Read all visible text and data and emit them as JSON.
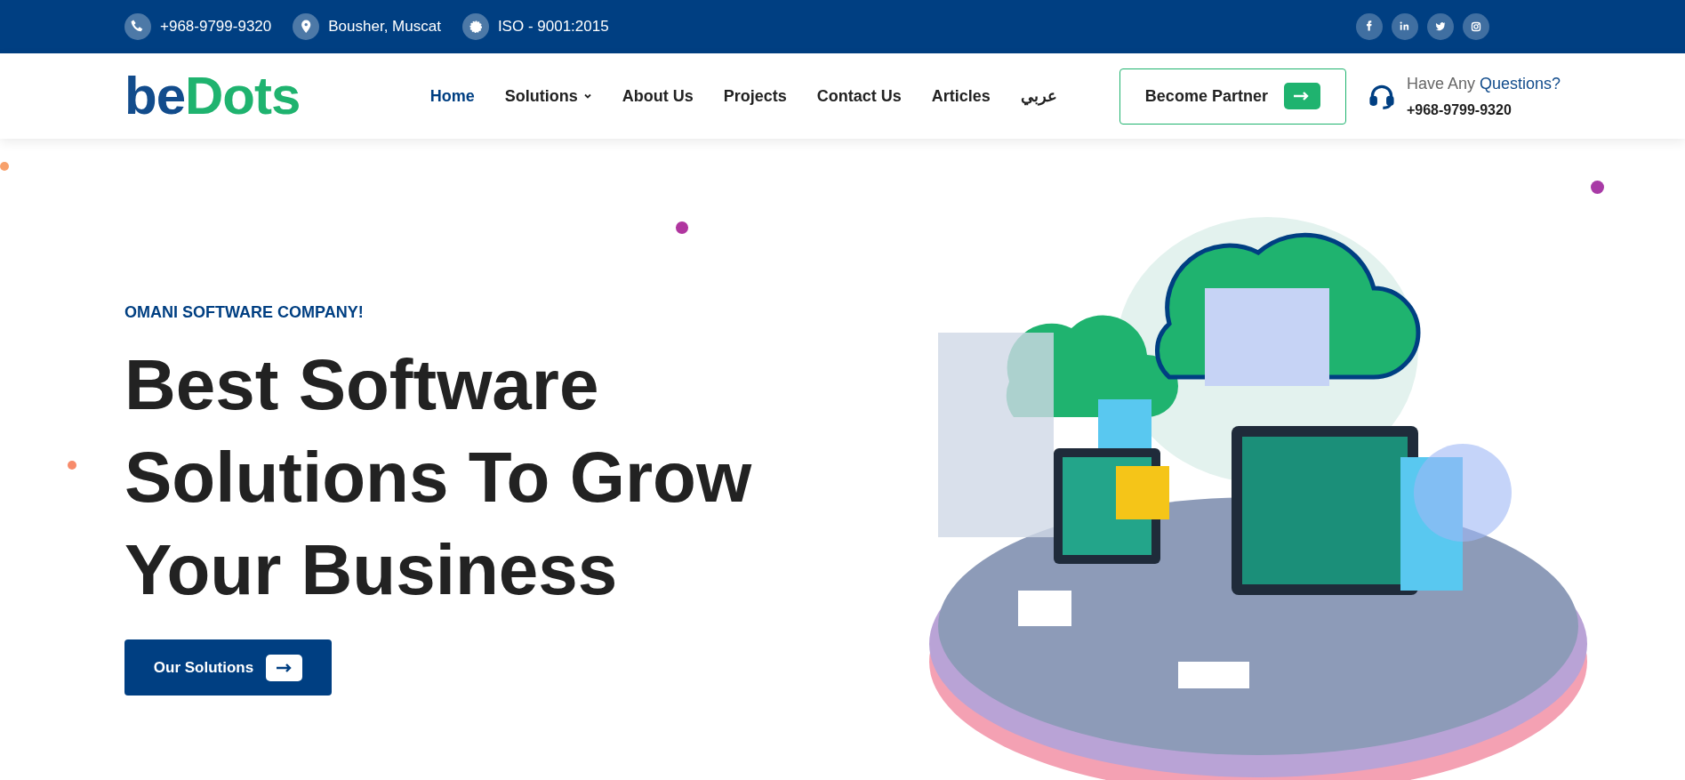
{
  "top_bar": {
    "contacts": [
      {
        "kind": "phone",
        "text": "+968-9799-9320"
      },
      {
        "kind": "location",
        "text": "Bousher, Muscat"
      },
      {
        "kind": "certificate",
        "text": "ISO - 9001:2015"
      }
    ],
    "social": [
      {
        "kind": "facebook"
      },
      {
        "kind": "linkedin"
      },
      {
        "kind": "twitter"
      },
      {
        "kind": "instagram"
      }
    ]
  },
  "header": {
    "logo": {
      "lead": "be",
      "rest": "Dots"
    },
    "nav": [
      {
        "label": "Home",
        "selected": true,
        "dropdown": false
      },
      {
        "label": "Solutions",
        "selected": false,
        "dropdown": true
      },
      {
        "label": "About Us",
        "selected": false,
        "dropdown": false
      },
      {
        "label": "Projects",
        "selected": false,
        "dropdown": false
      },
      {
        "label": "Contact Us",
        "selected": false,
        "dropdown": false
      },
      {
        "label": "Articles",
        "selected": false,
        "dropdown": false
      },
      {
        "label": "عربي",
        "selected": false,
        "dropdown": false
      }
    ],
    "partner_button": "Become Partner",
    "help": {
      "lead": "Have Any",
      "highlight": "Questions?",
      "phone": "+968-9799-9320"
    }
  },
  "hero": {
    "eyebrow": "OMANI SOFTWARE COMPANY!",
    "headline": [
      "Best Software",
      "Solutions To Grow",
      "Your Business"
    ],
    "button": "Our Solutions"
  }
}
